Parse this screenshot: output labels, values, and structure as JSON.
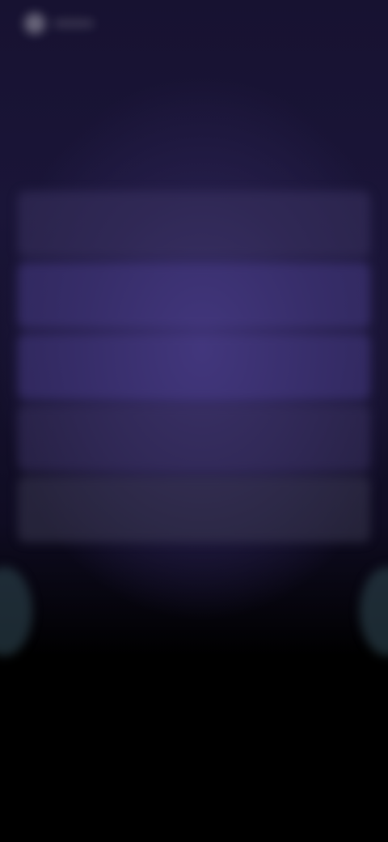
{
  "question": {
    "title": ""
  },
  "options": [
    {
      "label": ""
    },
    {
      "label": ""
    },
    {
      "label": ""
    },
    {
      "label": ""
    },
    {
      "label": ""
    }
  ],
  "colors": {
    "background_top": "#171231",
    "accent_glow": "#3a2f6e",
    "option_bg": "#3c3464",
    "bottom": "#000000"
  },
  "icons": {
    "back": "back-arrow-icon"
  }
}
